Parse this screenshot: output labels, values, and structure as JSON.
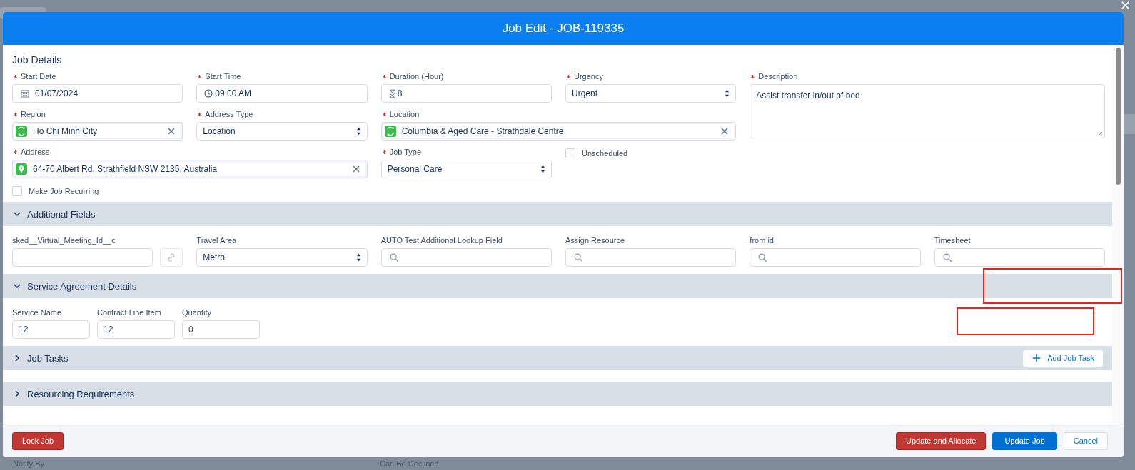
{
  "window": {
    "title": "Job Edit - JOB-119335"
  },
  "backdrop": {
    "texts": [
      "Notify By",
      "Can Be Declined"
    ]
  },
  "job_details": {
    "title": "Job Details",
    "fields": [
      {
        "label": "Start Date",
        "required": true,
        "kind": "date",
        "value": "01/07/2024"
      },
      {
        "label": "Start Time",
        "required": true,
        "kind": "time",
        "value": "09:00 AM"
      },
      {
        "label": "Duration (Hour)",
        "required": true,
        "kind": "duration",
        "value": "8"
      },
      {
        "label": "Urgency",
        "required": true,
        "kind": "select",
        "value": "Urgent"
      },
      {
        "label": "Description",
        "required": true,
        "kind": "textarea",
        "value": "Assist transfer in/out of bed"
      },
      {
        "label": "Region",
        "required": true,
        "kind": "lookup",
        "value": "Ho Chi Minh City"
      },
      {
        "label": "Address Type",
        "required": true,
        "kind": "select",
        "value": "Location"
      },
      {
        "label": "Location",
        "required": true,
        "kind": "lookup",
        "value": "Columbia & Aged Care - Strathdale Centre"
      },
      {
        "label": "Address",
        "required": true,
        "kind": "address",
        "value": "64-70 Albert Rd, Strathfield NSW 2135, Australia"
      },
      {
        "label": "Job Type",
        "required": true,
        "kind": "select",
        "value": "Personal Care"
      },
      {
        "label": "Unscheduled",
        "kind": "checkbox",
        "checked": false
      },
      {
        "label": "Make Job Recurring",
        "kind": "checkbox",
        "checked": false
      }
    ]
  },
  "sections": [
    {
      "title": "Additional Fields",
      "expanded": true,
      "fields": [
        {
          "label": "sked__Virtual_Meeting_Id__c",
          "kind": "link-text"
        },
        {
          "label": "Travel Area",
          "kind": "select",
          "value": "Metro"
        },
        {
          "label": "AUTO Test Additional Lookup Field",
          "kind": "search"
        },
        {
          "label": "Assign Resource",
          "kind": "search"
        },
        {
          "label": "from id",
          "kind": "search"
        },
        {
          "label": "Timesheet",
          "kind": "search"
        }
      ]
    },
    {
      "title": "Service Agreement Details",
      "expanded": true,
      "annotations": [
        {
          "kind": "highlight-box",
          "color": "#e8231b"
        },
        {
          "kind": "highlight-box",
          "color": "#e8231b"
        }
      ],
      "fields": [
        {
          "label": "Service Name",
          "kind": "text",
          "value": "12"
        },
        {
          "label": "Contract Line Item",
          "kind": "text",
          "value": "12"
        },
        {
          "label": "Quantity",
          "kind": "text",
          "value": "0"
        }
      ]
    },
    {
      "title": "Job Tasks",
      "expanded": false,
      "action": "Add Job Task"
    },
    {
      "title": "Resourcing Requirements",
      "expanded": false
    }
  ],
  "footer": {
    "buttons": [
      {
        "label": "Lock Job",
        "kind": "destructive"
      },
      {
        "label": "Update and Allocate",
        "kind": "destructive"
      },
      {
        "label": "Update Job",
        "kind": "brand"
      },
      {
        "label": "Cancel",
        "kind": "neutral"
      }
    ]
  }
}
